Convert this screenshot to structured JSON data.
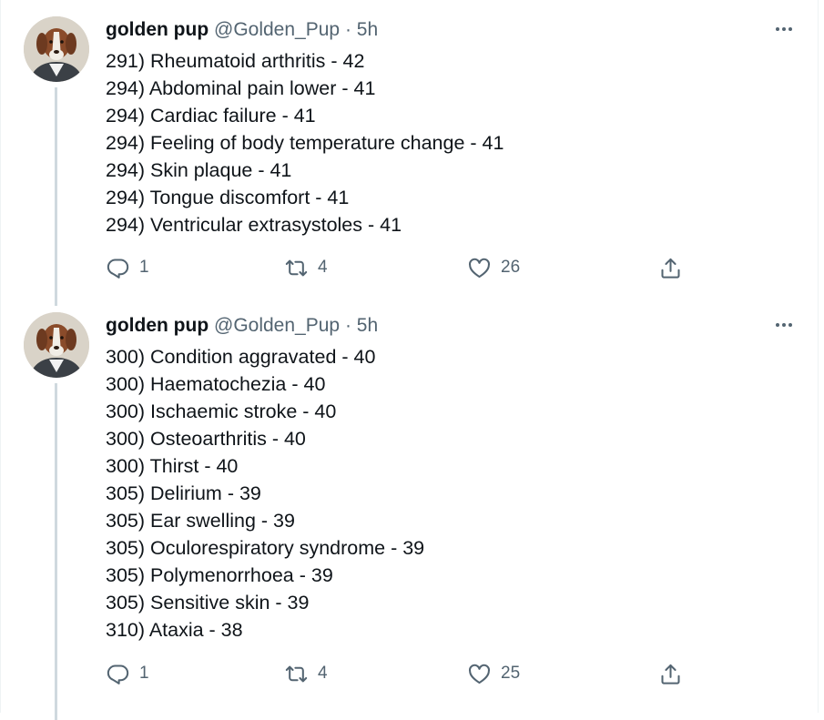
{
  "tweets": [
    {
      "author": {
        "name": "golden pup",
        "handle": "@Golden_Pup",
        "separator": "·",
        "time": "5h"
      },
      "lines": [
        "291) Rheumatoid arthritis - 42",
        "294) Abdominal pain lower - 41",
        "294) Cardiac failure - 41",
        "294) Feeling of body temperature change - 41",
        "294) Skin plaque - 41",
        "294) Tongue discomfort - 41",
        "294) Ventricular extrasystoles - 41"
      ],
      "stats": {
        "replies": "1",
        "retweets": "4",
        "likes": "26"
      }
    },
    {
      "author": {
        "name": "golden pup",
        "handle": "@Golden_Pup",
        "separator": "·",
        "time": "5h"
      },
      "lines": [
        "300) Condition aggravated - 40",
        "300) Haematochezia - 40",
        "300) Ischaemic stroke - 40",
        "300) Osteoarthritis - 40",
        "300) Thirst - 40",
        "305) Delirium - 39",
        "305) Ear swelling - 39",
        "305) Oculorespiratory syndrome - 39",
        "305) Polymenorrhoea - 39",
        "305) Sensitive skin - 39",
        "310) Ataxia - 38"
      ],
      "stats": {
        "replies": "1",
        "retweets": "4",
        "likes": "25"
      }
    }
  ],
  "icons": {
    "avatar": "dog-portrait-avatar",
    "more": "more-horizontal-icon",
    "reply": "reply-icon",
    "retweet": "retweet-icon",
    "like": "heart-icon",
    "share": "share-icon"
  },
  "colors": {
    "text_primary": "#0f1419",
    "text_secondary": "#536471",
    "thread_line": "#cfd9de",
    "divider": "#eff3f4"
  }
}
